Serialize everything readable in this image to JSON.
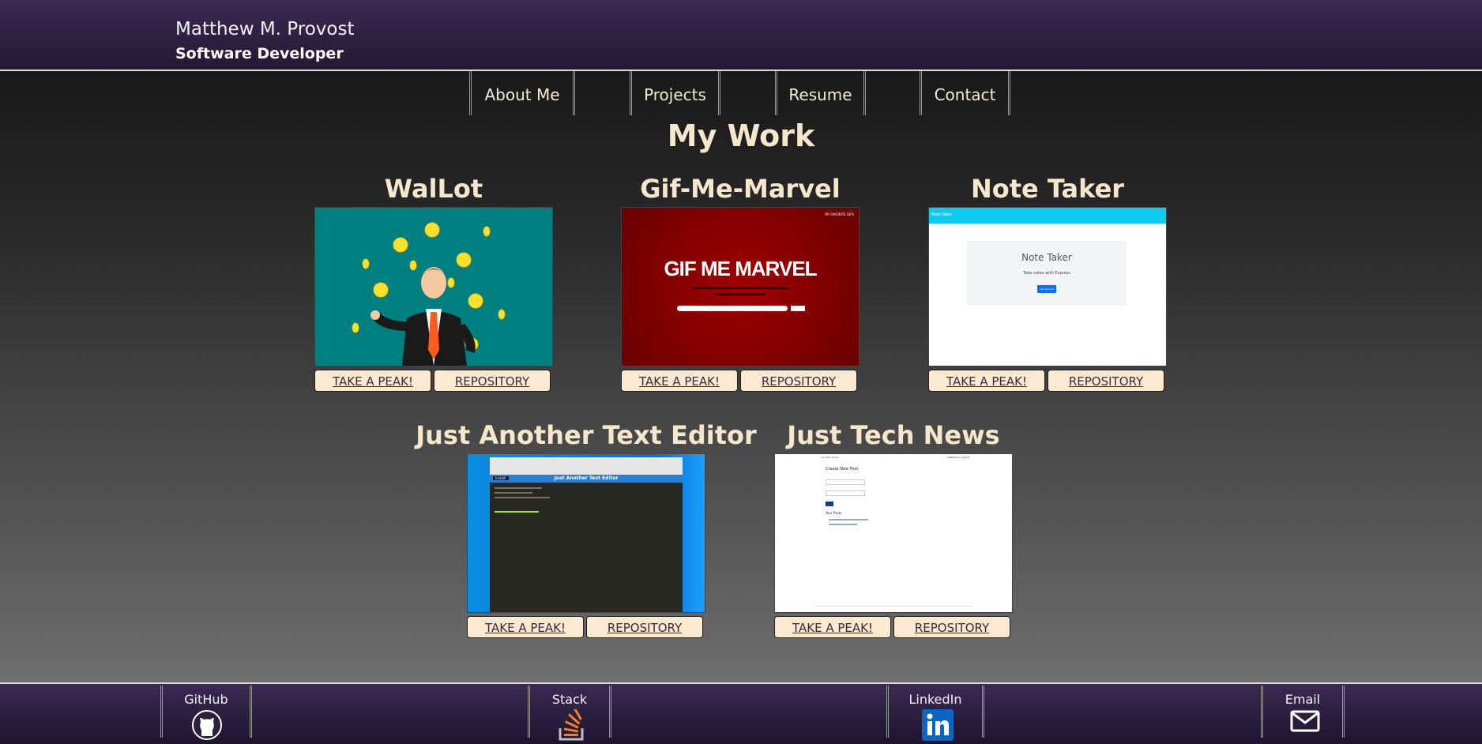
{
  "header": {
    "name": "Matthew M. Provost",
    "role": "Software Developer"
  },
  "nav": {
    "items": [
      "About Me",
      "Projects",
      "Resume",
      "Contact"
    ]
  },
  "main": {
    "title": "My Work",
    "projects": [
      {
        "title": "WalLot",
        "peek_label": "TAKE A PEAK!",
        "repo_label": "REPOSITORY"
      },
      {
        "title": "Gif-Me-Marvel",
        "peek_label": "TAKE A PEAK!",
        "repo_label": "REPOSITORY",
        "thumb": {
          "logo": "GIF ME MARVEL",
          "corner": "MY FAVORITE GIFS"
        }
      },
      {
        "title": "Note Taker",
        "peek_label": "TAKE A PEAK!",
        "repo_label": "REPOSITORY",
        "thumb": {
          "bar": "Note Taker",
          "heading": "Note Taker",
          "sub": "Take notes with Express",
          "button": "Get Started"
        }
      },
      {
        "title": "Just Another Text Editor",
        "peek_label": "TAKE A PEAK!",
        "repo_label": "REPOSITORY",
        "thumb": {
          "header": "Just Another Text Editor",
          "install": "Install!"
        }
      },
      {
        "title": "Just Tech News",
        "peek_label": "TAKE A PEAK!",
        "repo_label": "REPOSITORY",
        "thumb": {
          "brand": "Just Tech News",
          "nav": "dashboard | logout",
          "heading": "Create New Post",
          "posts": "Your Posts"
        }
      }
    ]
  },
  "footer": {
    "links": [
      "GitHub",
      "Stack",
      "LinkedIn",
      "Email"
    ]
  },
  "colors": {
    "header_purple": "#3b2a52",
    "accent_cream": "#f6e7cc",
    "button_bg": "#fbe9d2",
    "note_bar": "#0dcaf0",
    "marvel_red": "#8c0000",
    "wallot_teal": "#007f80"
  }
}
